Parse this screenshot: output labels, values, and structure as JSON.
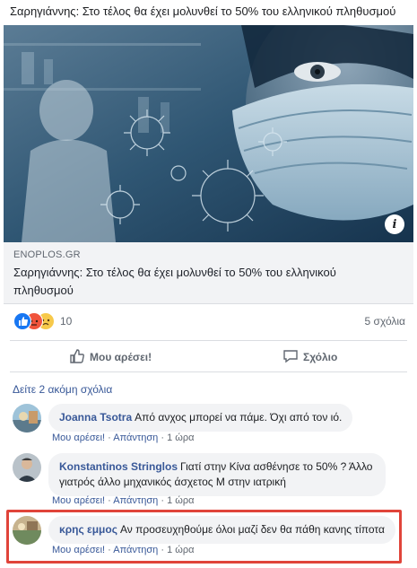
{
  "post": {
    "text": "Σαρηγιάννης: Στο τέλος θα έχει μολυνθεί το 50% του ελληνικού πληθυσμού"
  },
  "link": {
    "domain": "ENOPLOS.GR",
    "title": "Σαρηγιάννης: Στο τέλος θα έχει μολυνθεί το 50% του ελληνικού πληθυσμού",
    "info_icon": "i"
  },
  "reactions": {
    "count": "10",
    "comments": "5 σχόλια",
    "icons": [
      "like-icon",
      "angry-icon",
      "sad-icon"
    ],
    "colors": {
      "like": "#1877f2",
      "angry": "#f0543c",
      "sad": "#f7c94a"
    }
  },
  "actions": {
    "like": "Μου αρέσει!",
    "comment": "Σχόλιο"
  },
  "more_comments": "Δείτε 2 ακόμη σχόλια",
  "comments": [
    {
      "author": "Joanna Tsotra",
      "text": "Από ανχος μπορεί να πάμε. Όχι από τον ιό.",
      "like": "Μου αρέσει!",
      "reply": "Απάντηση",
      "time": "1 ώρα"
    },
    {
      "author": "Konstantinos Stringlos",
      "text": "Γιατί στην Κίνα ασθένησε το 50% ? Άλλο",
      "text2": "γιατρός άλλο μηχανικός άσχετος Μ στην ιατρική",
      "like": "Μου αρέσει!",
      "reply": "Απάντηση",
      "time": "1 ώρα"
    },
    {
      "author": "κρης εμμος",
      "text": "Αν προσευχηθούμε όλοι μαζί δεν θα πάθη κανης τίποτα",
      "like": "Μου αρέσει!",
      "reply": "Απάντηση",
      "time": "1 ώρα"
    }
  ],
  "separator": "·",
  "colors": {
    "link": "#385898",
    "highlight": "#e0443a"
  }
}
